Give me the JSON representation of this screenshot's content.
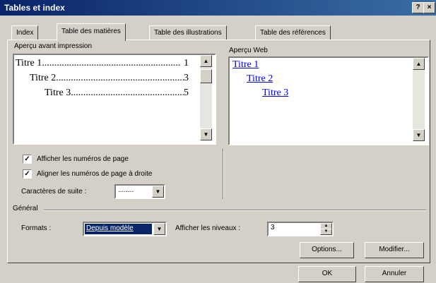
{
  "window": {
    "title": "Tables et index",
    "help_label": "?",
    "close_label": "×"
  },
  "tabs": [
    {
      "label": "Index"
    },
    {
      "label": "Table des matières"
    },
    {
      "label": "Table des illustrations"
    },
    {
      "label": "Table des références"
    }
  ],
  "print_preview": {
    "label": "Aperçu avant impression",
    "lines": [
      {
        "text": "Titre 1",
        "page": "1"
      },
      {
        "text": "Titre 2",
        "page": "3"
      },
      {
        "text": "Titre 3",
        "page": "5"
      }
    ]
  },
  "web_preview": {
    "label": "Aperçu Web",
    "links": [
      "Titre 1",
      "Titre 2",
      "Titre 3"
    ]
  },
  "options": {
    "show_page_numbers": {
      "label": "Afficher les numéros de page",
      "checked": true
    },
    "align_right": {
      "label": "Aligner les numéros de page à droite",
      "checked": true
    },
    "leader_label": "Caractères de suite :",
    "leader_value": "........"
  },
  "general": {
    "label": "Général",
    "formats_label": "Formats :",
    "formats_value": "Depuis modèle",
    "levels_label": "Afficher les niveaux :",
    "levels_value": "3"
  },
  "buttons": {
    "options": "Options...",
    "modify": "Modifier...",
    "ok": "OK",
    "cancel": "Annuler"
  },
  "icons": {
    "up": "▲",
    "down": "▼",
    "check": "✓"
  }
}
